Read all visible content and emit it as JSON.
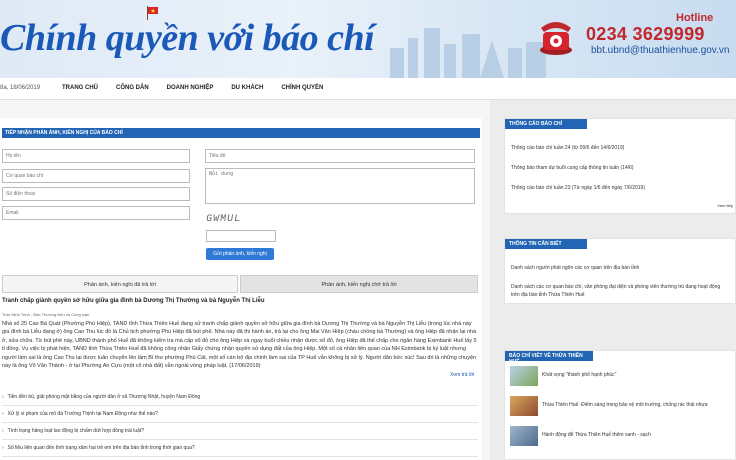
{
  "header": {
    "title": "Chính quyền với báo chí",
    "hotline_label": "Hotline",
    "hotline_number": "0234 3629999",
    "email": "bbt.ubnd@thuathienhue.gov.vn"
  },
  "nav": {
    "date": "8a, 18/06/2019",
    "items": [
      "TRANG CHỦ",
      "CÔNG DÂN",
      "DOANH NGHIỆP",
      "DU KHÁCH",
      "CHÍNH QUYỀN"
    ]
  },
  "form": {
    "title": "TIẾP NHẬN PHẢN ÁNH, KIẾN NGHỊ CỦA BÁO CHÍ",
    "fullname_placeholder": "Họ tên",
    "agency_placeholder": "Cơ quan báo chí",
    "phone_placeholder": "Số điện thoại",
    "email_placeholder": "Email",
    "subject_placeholder": "Tiêu đề",
    "content_placeholder": "Nội dung",
    "captcha": "GWMUL",
    "submit_label": "Gửi phản ánh, kiến nghị"
  },
  "tabs": {
    "answered": "Phản ánh, kiến nghị đã trả lời",
    "pending": "Phản ánh, kiến nghị chờ trả lời"
  },
  "article": {
    "title": "Tranh chấp giành quyền sở hữu giữa gia đình bà Dương Thị Thường và bà Nguyễn Thị Liễu",
    "meta": "Trần Minh Trịnh - Báo Thương hiệu và Công luận",
    "body": "Nhà số 25 Cao Bá Quát (Phường Phú Hiệp), TAND tỉnh Thừa Thiên Huế đang xử tranh chấp giành quyền sở hữu giữa gia đình bà Dương Thị Thường và bà Nguyễn Thị Liễu (trong lúc nhà này gia đình bà Liễu đang ở) ông Cao Thu lúc đó là Chủ tịch phường Phú Hiệp đã bút phê. Nhà này đã thi hành án, trả lại cho ông Mai Văn Hiệp (cháu chồng bà Thường) và ông Hiệp đã nhận lại nhà ở, sửa chữa. Từ bút phê này, UBND thành phố Huế đã không kiểm tra mà cấp sổ đỏ cho ông Hiệp và ngay buổi chiều nhận được sổ đỏ, ông Hiệp đã thế chấp cho ngân hàng Eximbank Huế lấy 5 tỉ đồng. Vụ việc bị phát hiện, TAND tỉnh Thừa Thiên Huế đã không công nhận Giấy chứng nhận quyền sử dụng đất của ông Hiệp. Một số cá nhân liên quan của NH Eximbank bị kỷ luật nhưng người làm sai là ông Cao Thu lại được luân chuyển lên làm Bí thư phường Phú Cát, một số cán bộ địa chính làm sai của TP Huế vẫn không bị xử lý. Người dân bức xúc! Sau đó là những chuyện này là ông Võ Văn Thành - ở tại Phường An Cựu (một cô nhà đất) vẫn ngoài vòng pháp luật. (17/06/2019)",
    "read_more": "Xem trả lời"
  },
  "list": [
    "Tiền đền bù, giải phóng mặt bằng của người dân ở xã Thượng Nhật, huyện Nam Đông",
    "Xử lý vi phạm của mô đá Trường Thịnh tại Nam Đông như thế nào?",
    "Tình trạng hàng loạt lao động bị chấm dứt hợp đồng trái luật?",
    "Số liệu liên quan đến tình trạng xâm hại trẻ em trên địa bàn tỉnh trong thời gian qua?"
  ],
  "sidebar": {
    "press_title": "THÔNG CÁO BÁO CHÍ",
    "press_items": [
      "Thông cáo báo chí tuần 24 (từ 09/6 đến 14/6/2019)",
      "Thông báo tham dự buổi cung cấp thông tin tuần (14/6)",
      "Thông cáo báo chí tuần 23 (Từ ngày 1/6 đến ngày 7/6/2019)"
    ],
    "press_more": "Xem tiếp",
    "info_title": "THÔNG TIN CẦN BIẾT",
    "info_items": [
      "Danh sách người phát ngôn các cơ quan trên địa bàn tỉnh",
      "Danh sách các cơ quan báo chí, văn phòng đại diện và phóng viên thường trú đang hoạt động trên địa bàn tỉnh Thừa Thiên Huế"
    ],
    "news_title": "BÁO CHÍ VIẾT VỀ THỪA THIÊN HUẾ",
    "news_items": [
      "Khát vọng \"thành phố hạnh phúc\"",
      "Thừa Thiên Huế: Điểm sáng trong bảo vệ môi trường, chống rác thải nhựa",
      "Hành động để Thừa Thiên Huế thêm xanh - sạch"
    ]
  }
}
